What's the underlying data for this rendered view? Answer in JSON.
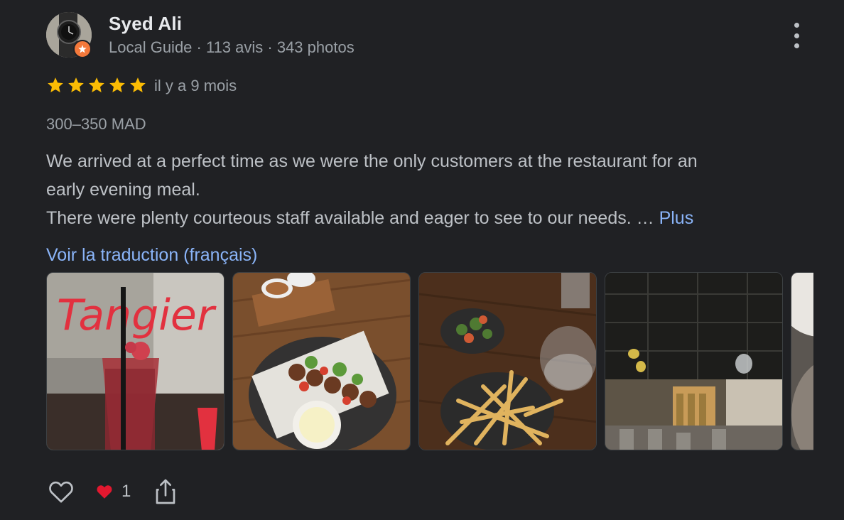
{
  "reviewer": {
    "name": "Syed Ali",
    "meta": "Local Guide · 113 avis · 343 photos",
    "badge_icon": "local-guide-star-icon"
  },
  "rating": {
    "stars": 5,
    "max": 5,
    "when": "il y a 9 mois"
  },
  "price_range": "300–350 MAD",
  "review": {
    "line1": "We arrived at a perfect time as we were the only customers at the restaurant for an",
    "line2": "early evening meal.",
    "line3": "There were plenty courteous staff available and eager to see to our needs. … ",
    "more_label": "Plus"
  },
  "translate_label": "Voir la traduction (français)",
  "photos": [
    {
      "icon": "cocktail-photo"
    },
    {
      "icon": "skewers-photo"
    },
    {
      "icon": "fries-photo"
    },
    {
      "icon": "restaurant-interior-photo"
    },
    {
      "icon": "plate-photo"
    }
  ],
  "actions": {
    "like_icon": "heart-outline-icon",
    "reaction_icon": "red-heart-icon",
    "reaction_count": "1",
    "share_icon": "share-icon"
  },
  "colors": {
    "background": "#202124",
    "link": "#8ab4f8",
    "star": "#fbbc04",
    "badge": "#f4793b"
  }
}
